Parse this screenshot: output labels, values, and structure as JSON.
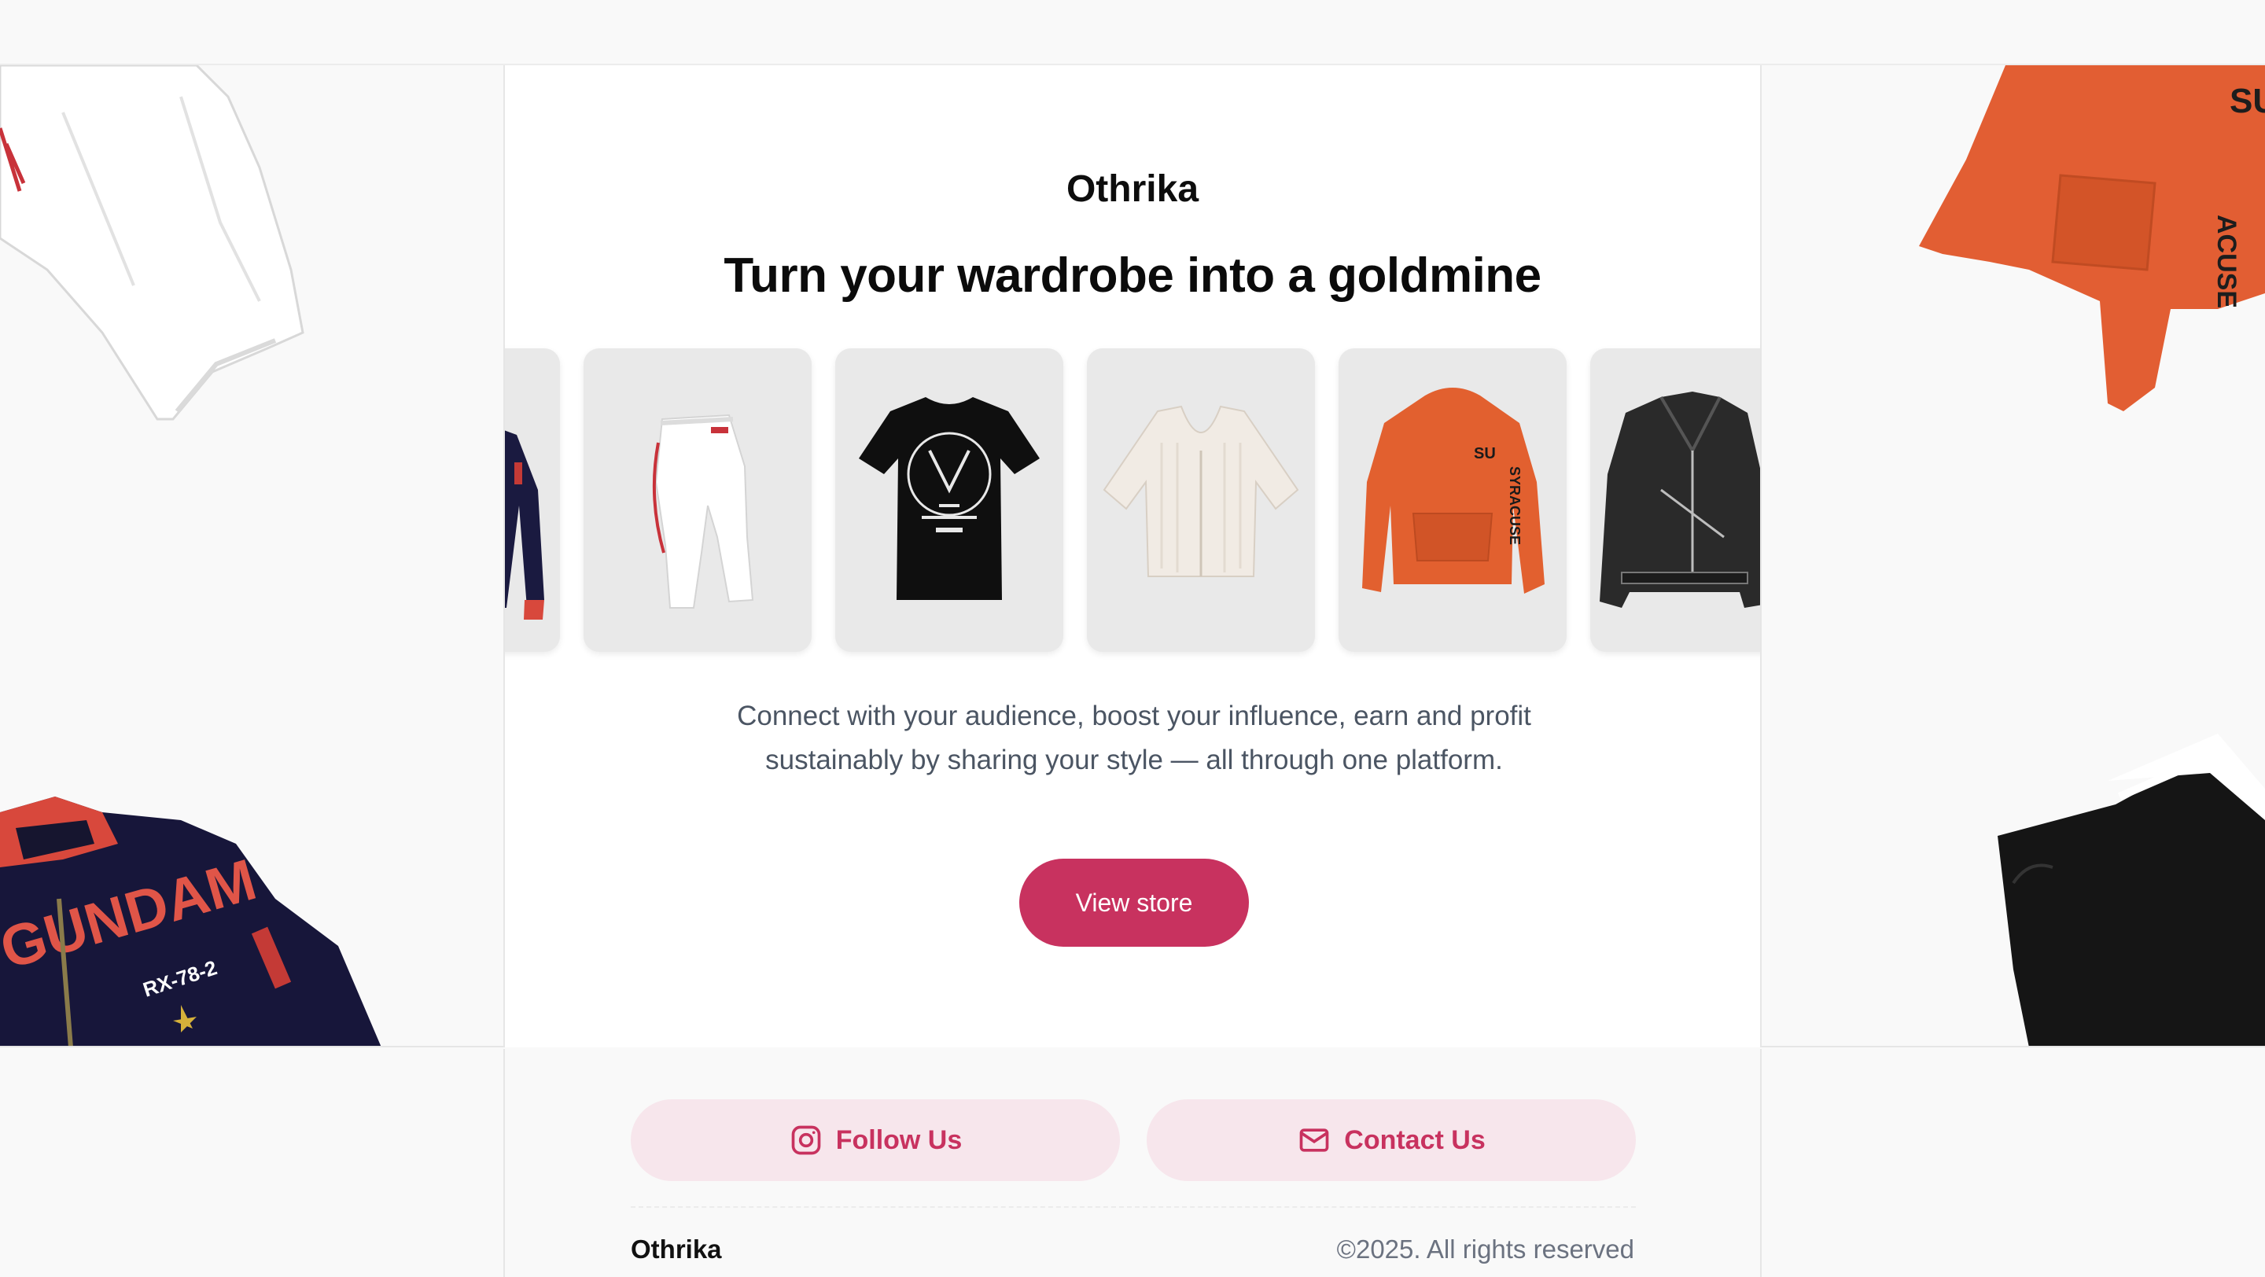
{
  "brand": {
    "name": "Othrika"
  },
  "hero": {
    "headline": "Turn your wardrobe into a goldmine",
    "description": "Connect with your audience, boost your influence, earn and profit sustainably by sharing your style — all through one platform.",
    "cta_label": "View store"
  },
  "products": [
    {
      "name": "navy-bomber-jacket"
    },
    {
      "name": "white-sweatpants"
    },
    {
      "name": "black-graphic-tshirt"
    },
    {
      "name": "cream-knit-crop-top"
    },
    {
      "name": "orange-syracuse-hoodie"
    },
    {
      "name": "black-leather-jacket"
    }
  ],
  "footer": {
    "follow_label": "Follow Us",
    "contact_label": "Contact Us",
    "brand": "Othrika",
    "copyright": "©2025. All rights reserved"
  },
  "colors": {
    "accent": "#c8325f",
    "pill_bg": "#f7e6ec",
    "card_bg": "#e9e9e9",
    "page_bg": "#f9f9f9"
  }
}
